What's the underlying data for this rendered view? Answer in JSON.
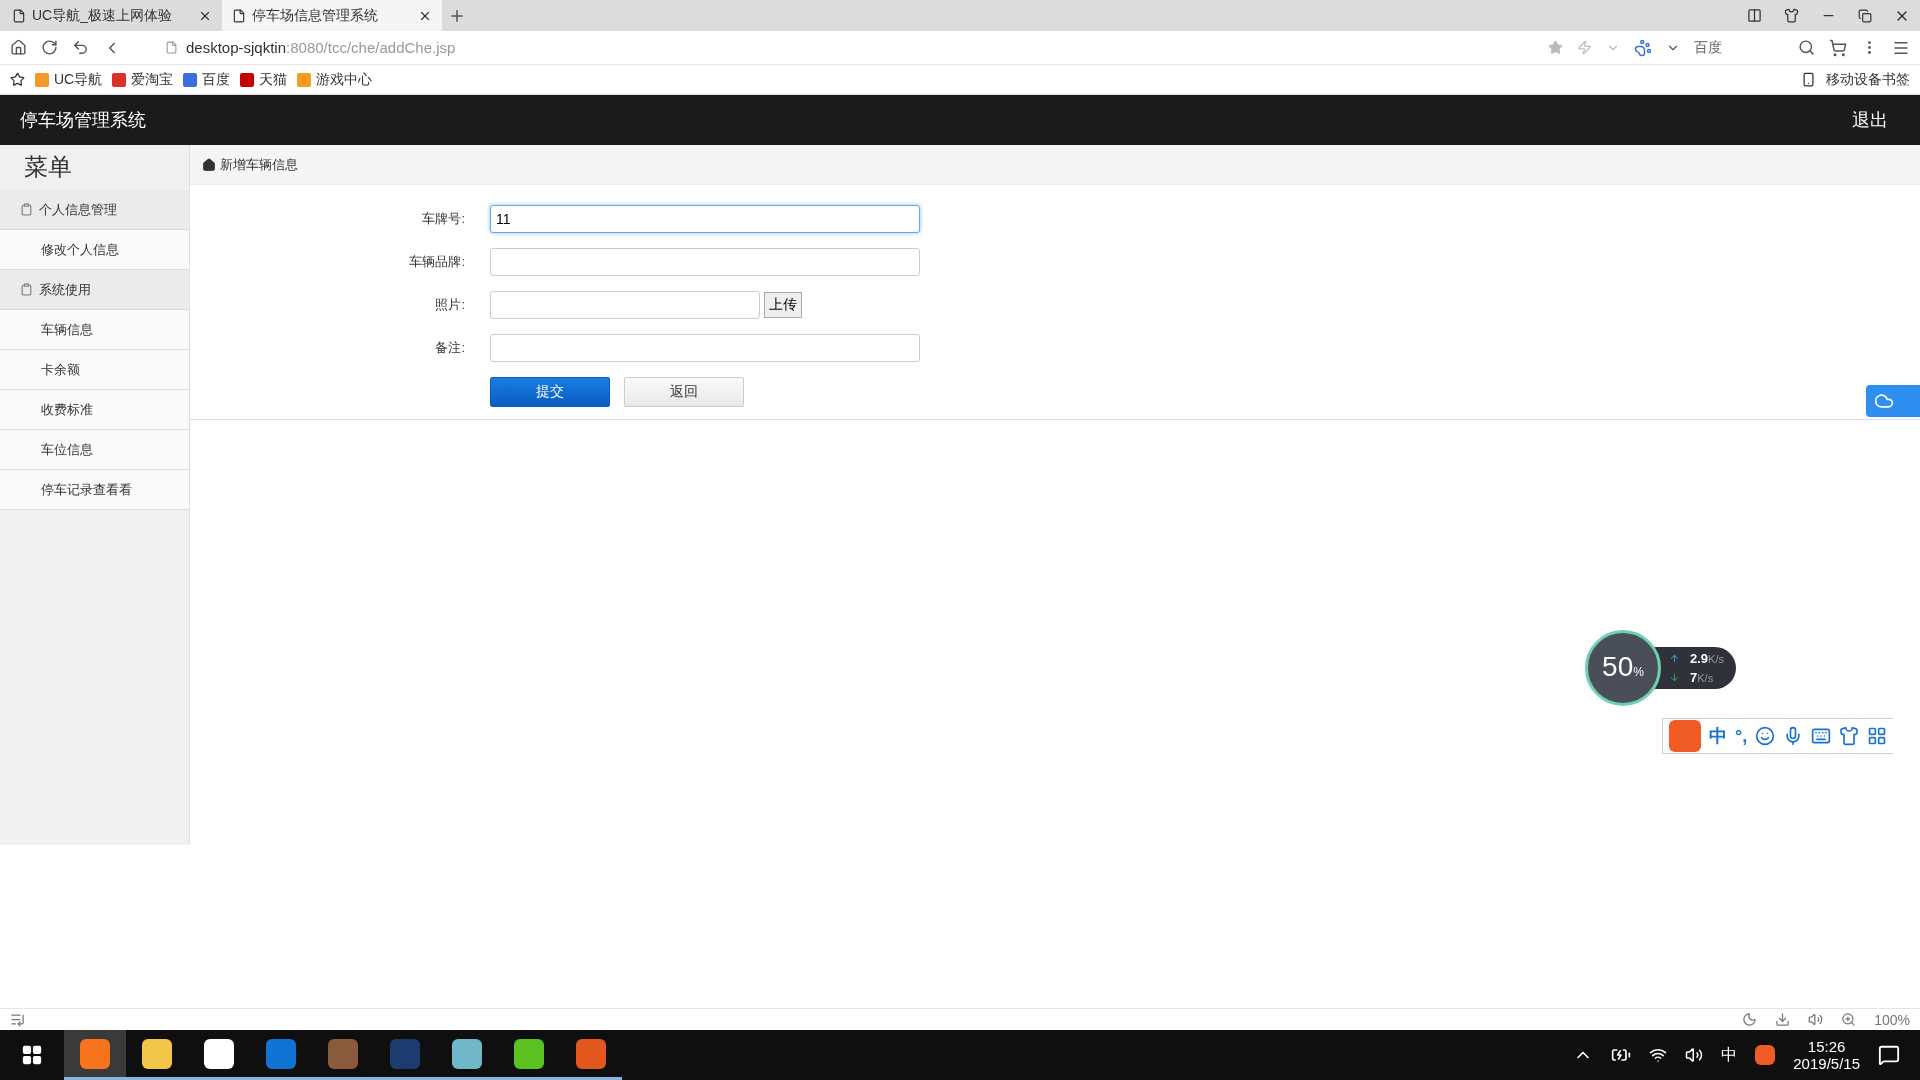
{
  "browser": {
    "tabs": [
      {
        "title": "UC导航_极速上网体验",
        "selected": false
      },
      {
        "title": "停车场信息管理系统",
        "selected": true
      }
    ],
    "address": {
      "host": "desktop-sjqktin",
      "path": ":8080/tcc/che/addChe.jsp"
    },
    "search_engine": "百度",
    "bookmarks": [
      {
        "label": "UC导航",
        "color": "#f59a23"
      },
      {
        "label": "爱淘宝",
        "color": "#d9302c"
      },
      {
        "label": "百度",
        "color": "#3a6fe0"
      },
      {
        "label": "天猫",
        "color": "#c40000"
      },
      {
        "label": "游戏中心",
        "color": "#f59a23"
      }
    ],
    "mobile_bookmarks": "移动设备书签"
  },
  "app": {
    "title": "停车场管理系统",
    "logout": "退出",
    "sidebar": {
      "heading": "菜单",
      "groups": [
        {
          "label": "个人信息管理",
          "items": [
            {
              "label": "修改个人信息"
            }
          ]
        },
        {
          "label": "系统使用",
          "items": [
            {
              "label": "车辆信息"
            },
            {
              "label": "卡余额"
            },
            {
              "label": "收费标准"
            },
            {
              "label": "车位信息"
            },
            {
              "label": "停车记录查看看"
            }
          ]
        }
      ]
    },
    "breadcrumb": "新增车辆信息",
    "form": {
      "fields": [
        {
          "label": "车牌号:",
          "kind": "text",
          "value": "11",
          "focused": true
        },
        {
          "label": "车辆品牌:",
          "kind": "text",
          "focused": false
        },
        {
          "label": "照片:",
          "kind": "file",
          "focused": false,
          "button": "上传"
        },
        {
          "label": "备注:",
          "kind": "text",
          "focused": false
        }
      ],
      "buttons": [
        {
          "label": "提交",
          "kind": "primary"
        },
        {
          "label": "返回",
          "kind": "default"
        }
      ]
    }
  },
  "speed_meter": {
    "percent": "50",
    "percent_sign": "%",
    "rates": [
      {
        "kind": "up",
        "value": "2.9",
        "unit": "K/s"
      },
      {
        "kind": "down",
        "value": "7",
        "unit": "K/s"
      }
    ]
  },
  "ime_bar": {
    "mode": "中",
    "punctuation": "°,"
  },
  "status_bar": {
    "zoom": "100%"
  },
  "taskbar": {
    "apps": [
      {
        "color": "#f7731c",
        "selected": true
      },
      {
        "color": "#f3c64a",
        "selected": false
      },
      {
        "color": "#ffffff",
        "selected": false
      },
      {
        "color": "#1173d4",
        "selected": false
      },
      {
        "color": "#8a5a3c",
        "selected": false
      },
      {
        "color": "#1d3b6e",
        "selected": false
      },
      {
        "color": "#6fb7c9",
        "selected": false
      },
      {
        "color": "#5cc21f",
        "selected": false
      },
      {
        "color": "#e2571e",
        "selected": false
      }
    ],
    "input_method": "中",
    "time": "15:26",
    "date": "2019/5/15"
  }
}
